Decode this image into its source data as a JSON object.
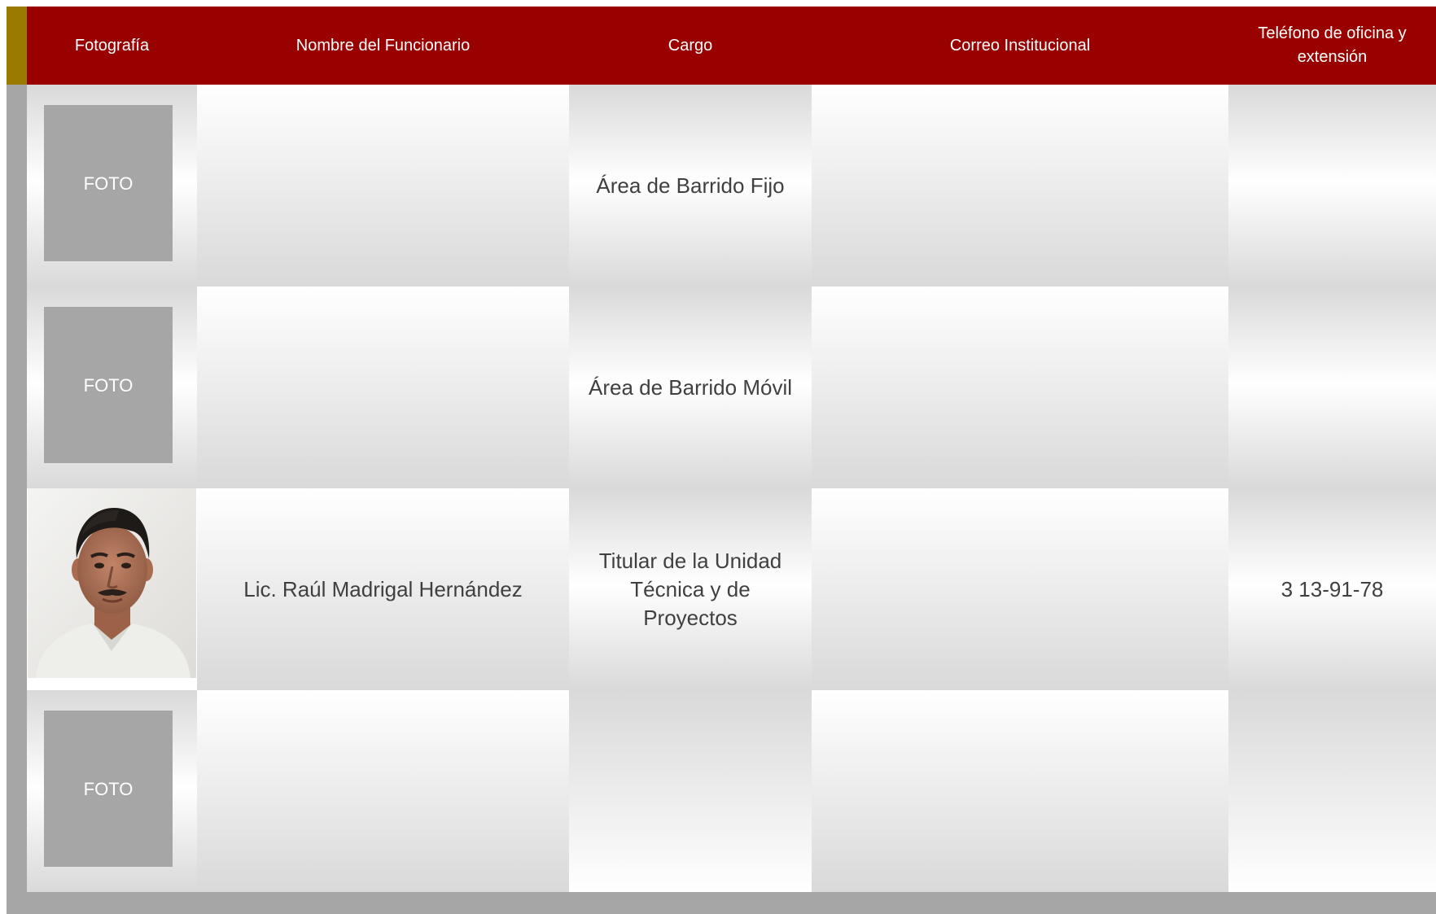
{
  "table": {
    "headers": {
      "photo": "Fotografía",
      "name": "Nombre del Funcionario",
      "position": "Cargo",
      "email": "Correo Institucional",
      "phone": "Teléfono de oficina y extensión"
    },
    "rows": [
      {
        "photo_placeholder": "FOTO",
        "name": "",
        "position": "Área de Barrido Fijo",
        "email": "",
        "phone": ""
      },
      {
        "photo_placeholder": "FOTO",
        "name": "",
        "position": "Área de Barrido Móvil",
        "email": "",
        "phone": ""
      },
      {
        "photo_placeholder": "",
        "name": "Lic. Raúl Madrigal Hernández",
        "position": "Titular de la Unidad Técnica y de Proyectos",
        "email": "",
        "phone": "3 13-91-78"
      },
      {
        "photo_placeholder": "FOTO",
        "name": "",
        "position": "",
        "email": "",
        "phone": ""
      }
    ]
  },
  "colors": {
    "header_bg": "#990000",
    "accent_tab": "#9b7a00",
    "frame_gray": "#a6a6a6",
    "text": "#404040"
  }
}
